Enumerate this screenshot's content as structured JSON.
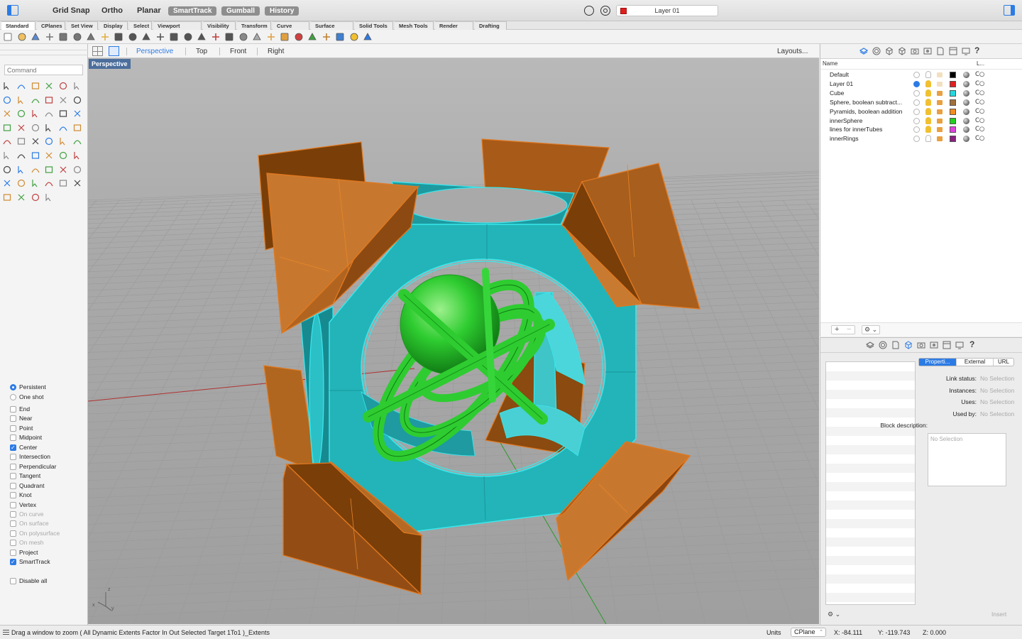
{
  "topbar": {
    "modes": [
      "Grid Snap",
      "Ortho",
      "Planar"
    ],
    "pills": [
      "SmartTrack",
      "Gumball",
      "History"
    ],
    "current_layer": "Layer 01",
    "current_layer_color": "#e02020"
  },
  "tabs": [
    "Standard",
    "CPlanes",
    "Set View",
    "Display",
    "Select",
    "Viewport Layout",
    "Visibility",
    "Transform",
    "Curve Tools",
    "Surface Tools",
    "Solid Tools",
    "Mesh Tools",
    "Render Tools",
    "Drafting"
  ],
  "command": {
    "placeholder": "Command"
  },
  "viewport_header": {
    "tabs": [
      "Perspective",
      "Top",
      "Front",
      "Right"
    ],
    "active_tab": "Perspective",
    "layouts_label": "Layouts..."
  },
  "viewport": {
    "label": "Perspective",
    "axis_labels": [
      "z",
      "x",
      "y"
    ],
    "colors": {
      "pyramids": "#d88530",
      "cube": "#22b4b8",
      "sphere": "#2ecc30",
      "background": "#a9a9a9"
    }
  },
  "osnaps": {
    "modes": [
      {
        "label": "Persistent",
        "type": "radio",
        "checked": true
      },
      {
        "label": "One shot",
        "type": "radio",
        "checked": false
      }
    ],
    "items": [
      {
        "label": "End",
        "checked": false,
        "dim": false
      },
      {
        "label": "Near",
        "checked": false,
        "dim": false
      },
      {
        "label": "Point",
        "checked": false,
        "dim": false
      },
      {
        "label": "Midpoint",
        "checked": false,
        "dim": false
      },
      {
        "label": "Center",
        "checked": true,
        "dim": false
      },
      {
        "label": "Intersection",
        "checked": false,
        "dim": false
      },
      {
        "label": "Perpendicular",
        "checked": false,
        "dim": false
      },
      {
        "label": "Tangent",
        "checked": false,
        "dim": false
      },
      {
        "label": "Quadrant",
        "checked": false,
        "dim": false
      },
      {
        "label": "Knot",
        "checked": false,
        "dim": false
      },
      {
        "label": "Vertex",
        "checked": false,
        "dim": false
      },
      {
        "label": "On curve",
        "checked": false,
        "dim": true
      },
      {
        "label": "On surface",
        "checked": false,
        "dim": true
      },
      {
        "label": "On polysurface",
        "checked": false,
        "dim": true
      },
      {
        "label": "On mesh",
        "checked": false,
        "dim": true
      },
      {
        "label": "Project",
        "checked": false,
        "dim": false
      },
      {
        "label": "SmartTrack",
        "checked": true,
        "dim": false
      }
    ],
    "disable_all": "Disable all"
  },
  "layers": {
    "headers": {
      "name": "Name",
      "linetype": "L..."
    },
    "rows": [
      {
        "name": "Default",
        "current": false,
        "on": false,
        "locked": false,
        "color": "#000000",
        "linetype": "C○"
      },
      {
        "name": "Layer 01",
        "current": true,
        "on": true,
        "locked": false,
        "color": "#e02020",
        "linetype": "C○"
      },
      {
        "name": "Cube",
        "current": false,
        "on": true,
        "locked": true,
        "color": "#22d8e0",
        "linetype": "C○"
      },
      {
        "name": "Sphere, boolean subtract...",
        "current": false,
        "on": true,
        "locked": true,
        "color": "#a0703a",
        "linetype": "C○"
      },
      {
        "name": "Pyramids, boolean addition",
        "current": false,
        "on": true,
        "locked": true,
        "color": "#f08c20",
        "linetype": "C○"
      },
      {
        "name": "innerSphere",
        "current": false,
        "on": true,
        "locked": true,
        "color": "#20d020",
        "linetype": "C○"
      },
      {
        "name": "lines for innerTubes",
        "current": false,
        "on": true,
        "locked": true,
        "color": "#e040e0",
        "linetype": "C○"
      },
      {
        "name": "innerRings",
        "current": false,
        "on": false,
        "locked": true,
        "color": "#8a2080",
        "linetype": "C○"
      }
    ],
    "add_label": "+",
    "remove_label": "−",
    "gear_label": "⚙ ⌄"
  },
  "properties": {
    "segments": [
      "Properti...",
      "External",
      "URL"
    ],
    "active_segment": "Properti...",
    "fields": [
      {
        "label": "Link status:",
        "value": "No Selection"
      },
      {
        "label": "Instances:",
        "value": "No Selection"
      },
      {
        "label": "Uses:",
        "value": "No Selection"
      },
      {
        "label": "Used by:",
        "value": "No Selection"
      }
    ],
    "block_description_label": "Block description:",
    "block_description_value": "No Selection",
    "insert_label": "Insert",
    "gear_label": "⚙ ⌄"
  },
  "status": {
    "message": "Drag a window to zoom ( All Dynamic Extents Factor In Out Selected Target 1To1 )_Extents",
    "units_label": "Units",
    "cplane": "CPlane",
    "x": "X: -84.111",
    "y": "Y: -119.743",
    "z": "Z: 0.000"
  }
}
